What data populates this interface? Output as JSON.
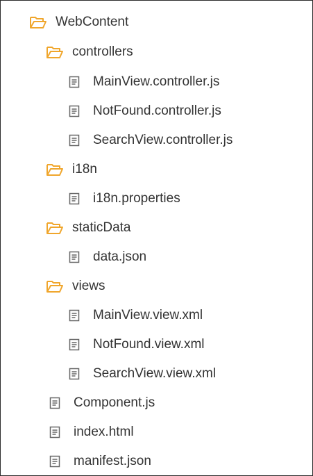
{
  "tree": {
    "nodes": [
      {
        "label": "WebContent",
        "type": "folder",
        "icon": "folder-open-icon"
      },
      {
        "label": "controllers",
        "type": "folder",
        "icon": "folder-open-icon"
      },
      {
        "label": "MainView.controller.js",
        "type": "file",
        "icon": "file-icon"
      },
      {
        "label": "NotFound.controller.js",
        "type": "file",
        "icon": "file-icon"
      },
      {
        "label": "SearchView.controller.js",
        "type": "file",
        "icon": "file-icon"
      },
      {
        "label": "i18n",
        "type": "folder",
        "icon": "folder-open-icon"
      },
      {
        "label": "i18n.properties",
        "type": "file",
        "icon": "file-icon"
      },
      {
        "label": "staticData",
        "type": "folder",
        "icon": "folder-open-icon"
      },
      {
        "label": "data.json",
        "type": "file",
        "icon": "file-icon"
      },
      {
        "label": "views",
        "type": "folder",
        "icon": "folder-open-icon"
      },
      {
        "label": "MainView.view.xml",
        "type": "file",
        "icon": "file-icon"
      },
      {
        "label": "NotFound.view.xml",
        "type": "file",
        "icon": "file-icon"
      },
      {
        "label": "SearchView.view.xml",
        "type": "file",
        "icon": "file-icon"
      },
      {
        "label": "Component.js",
        "type": "file",
        "icon": "file-icon"
      },
      {
        "label": "index.html",
        "type": "file",
        "icon": "file-icon"
      },
      {
        "label": "manifest.json",
        "type": "file",
        "icon": "file-icon"
      }
    ]
  },
  "colors": {
    "folder": "#f0a62c",
    "file_icon": "#666666",
    "text": "#333333"
  }
}
